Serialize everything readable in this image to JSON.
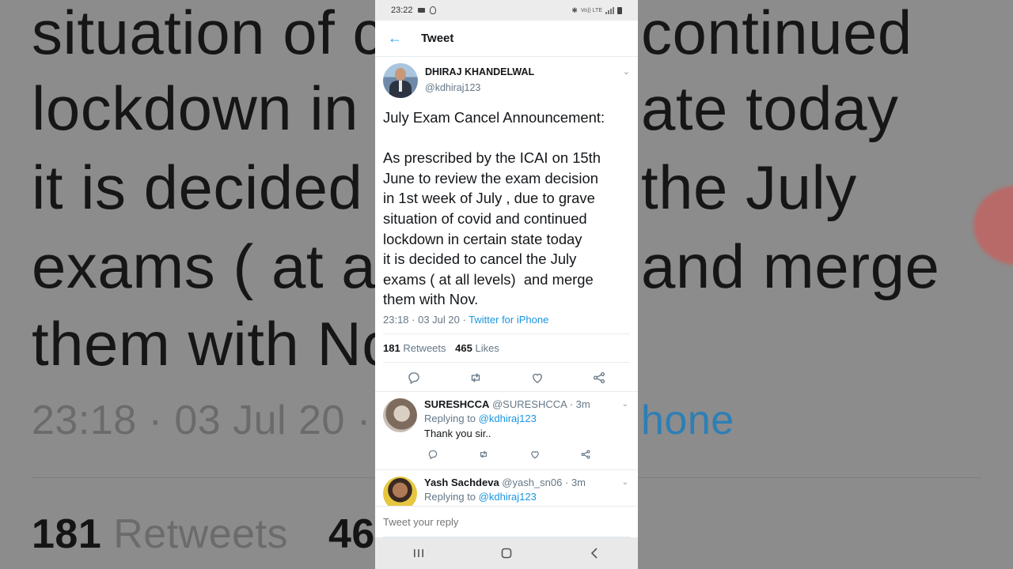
{
  "background": {
    "lines": [
      "situation of c",
      "continued",
      "lockdown in",
      "ate today",
      "it is decided",
      "the July",
      "exams ( at al",
      "and merge",
      "them with No"
    ],
    "meta_time": "23:18 · 03 Jul 20 ·",
    "meta_source": "hone",
    "stats_count": "181",
    "stats_label": "Retweets",
    "stats_likes_partial": "465"
  },
  "statusbar": {
    "time": "23:22",
    "net1": "Vo)) LTE",
    "net2": "LTE1 LTE"
  },
  "appbar": {
    "title": "Tweet"
  },
  "tweet": {
    "author_name": "DHIRAJ KHANDELWAL",
    "author_handle": "@kdhiraj123",
    "text": "July Exam Cancel Announcement:\n\nAs prescribed by the ICAI on 15th\nJune to review the exam decision\nin 1st week of July , due to grave\nsituation of covid and continued\nlockdown in certain state today\nit is decided to cancel the July\nexams ( at all levels)  and merge\nthem with Nov.",
    "timestamp": "23:18 · 03 Jul 20 · ",
    "source": "Twitter for iPhone",
    "retweets_count": "181",
    "retweets_label": "Retweets",
    "likes_count": "465",
    "likes_label": "Likes"
  },
  "replies": [
    {
      "name": "SURESHCCA",
      "handle": "@SURESHCCA",
      "time": "· 3m",
      "replying_prefix": "Replying to ",
      "replying_to": "@kdhiraj123",
      "text": "Thank you sir.."
    },
    {
      "name": "Yash Sachdeva",
      "handle": "@yash_sn06",
      "time": "· 3m",
      "replying_prefix": "Replying to ",
      "replying_to": "@kdhiraj123"
    }
  ],
  "compose": {
    "placeholder": "Tweet your reply"
  },
  "icons": {
    "back": "arrow-left-icon",
    "reply": "reply-icon",
    "retweet": "retweet-icon",
    "like": "heart-icon",
    "share": "share-icon"
  },
  "colors": {
    "accent": "#1da1f2",
    "link": "#1b95e0",
    "muted": "#657786",
    "text": "#14171a"
  }
}
